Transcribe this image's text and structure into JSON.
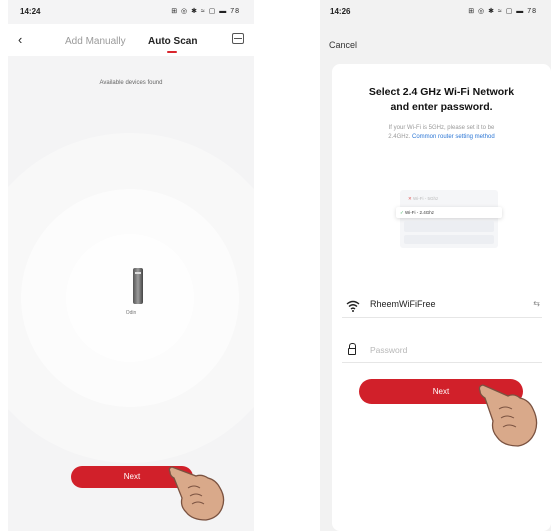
{
  "left_screen": {
    "status_time": "14:24",
    "status_icons": "⊞ ◎ ✱ ≈ ▢ ▬ 78",
    "tabs": [
      {
        "label": "Add Manually",
        "selected": false
      },
      {
        "label": "Auto Scan",
        "selected": true
      }
    ],
    "available_text": "Available devices found",
    "device_name": "Odin",
    "next_label": "Next"
  },
  "right_screen": {
    "status_time": "14:26",
    "status_icons": "⊞ ◎ ✱ ≈ ▢ ▬ 78",
    "cancel_label": "Cancel",
    "title_line1": "Select 2.4 GHz Wi-Fi Network",
    "title_line2": "and enter password.",
    "hint_line1": "If your Wi-Fi is 5GHz, please set it to be",
    "hint_line2_prefix": "2.4GHz.",
    "hint_link": "Common router setting method",
    "illustration": {
      "row1": "Wi-Fi - 5Ghz",
      "row2": "Wi-Fi - 2.4Ghz"
    },
    "wifi_ssid": "RheemWiFiFree",
    "password_placeholder": "Password",
    "password_value": "",
    "next_label": "Next"
  },
  "colors": {
    "accent": "#d1202a",
    "link": "#2d77d5"
  }
}
